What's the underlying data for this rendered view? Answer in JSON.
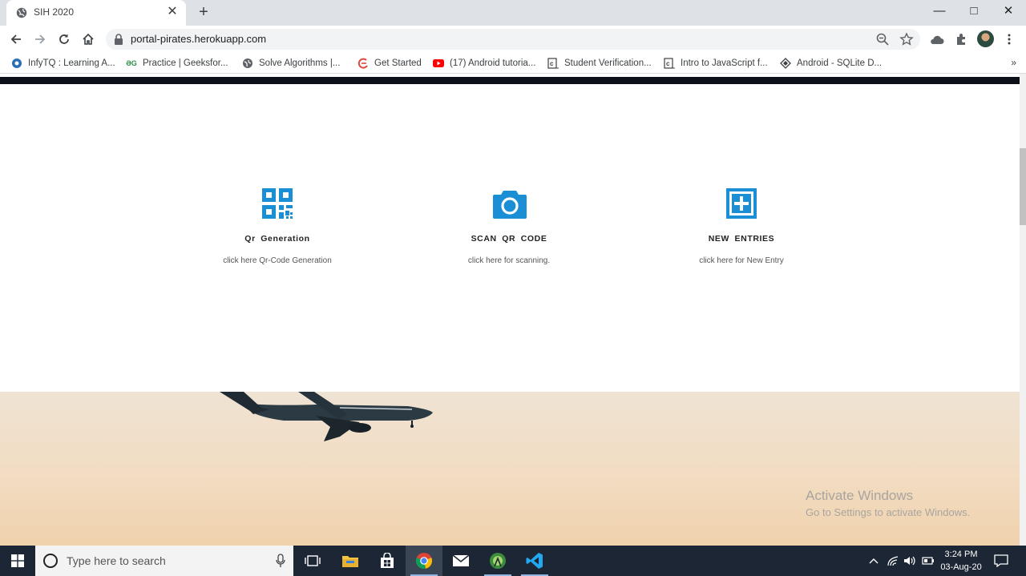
{
  "browser": {
    "tab": {
      "title": "SIH 2020"
    },
    "url": "portal-pirates.herokuapp.com",
    "window_controls": {
      "minimize": "—",
      "maximize": "□",
      "close": "✕"
    }
  },
  "bookmarks": [
    {
      "label": "InfyTQ : Learning A...",
      "icon": "infytq-icon",
      "color": "#2a6fb5"
    },
    {
      "label": "Practice | Geeksfor...",
      "icon": "geeksforgeeks-icon",
      "color": "#2f8d46"
    },
    {
      "label": "Solve Algorithms |...",
      "icon": "hackerrank-icon",
      "color": "#3c4043"
    },
    {
      "label": "Get Started",
      "icon": "get-started-icon",
      "color": "#e0483e"
    },
    {
      "label": "(17) Android tutoria...",
      "icon": "youtube-icon",
      "color": "#ff0000"
    },
    {
      "label": "Student Verification...",
      "icon": "doc-c-icon",
      "color": "#3c4043"
    },
    {
      "label": "Intro to JavaScript f...",
      "icon": "doc-c-icon",
      "color": "#3c4043"
    },
    {
      "label": "Android - SQLite D...",
      "icon": "android-sqlite-icon",
      "color": "#3c4043"
    }
  ],
  "bookmarks_more": "»",
  "features": [
    {
      "title": "Qr  Generation",
      "desc": "click here Qr-Code Generation",
      "icon": "qr-code-icon"
    },
    {
      "title": "SCAN  QR  CODE",
      "desc": "click here for scanning.",
      "icon": "camera-icon"
    },
    {
      "title": "NEW  ENTRIES",
      "desc": "click here for New Entry",
      "icon": "plus-square-icon"
    }
  ],
  "accent_color": "#1a8fd5",
  "watermark": {
    "line1": "Activate Windows",
    "line2": "Go to Settings to activate Windows."
  },
  "taskbar": {
    "search_placeholder": "Type here to search",
    "time": "3:24 PM",
    "date": "03-Aug-20"
  }
}
